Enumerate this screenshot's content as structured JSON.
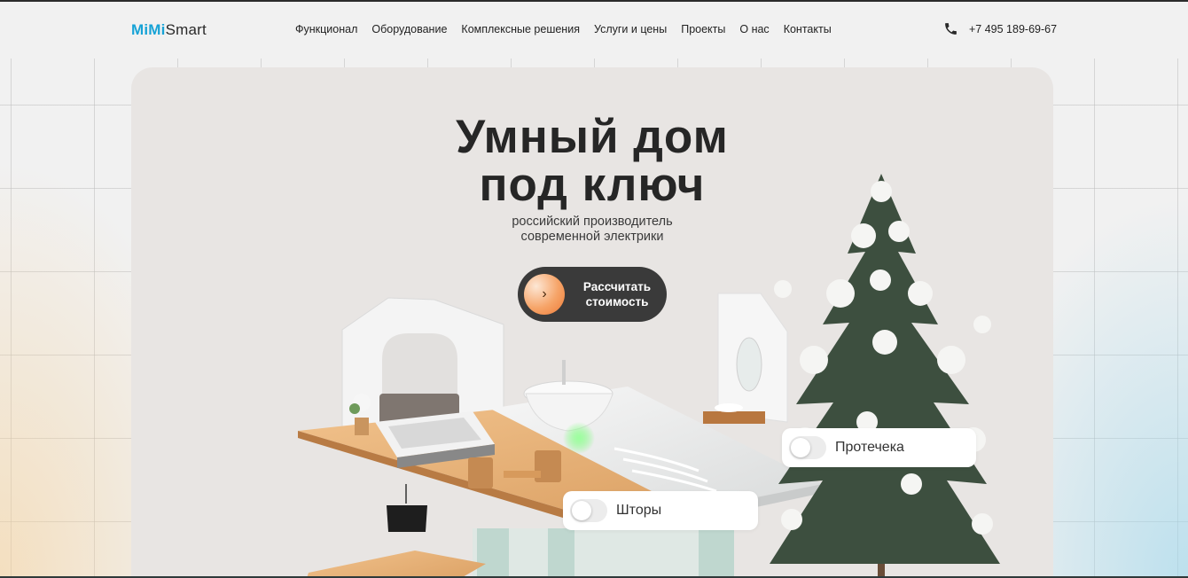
{
  "header": {
    "logo_part1": "MiMi",
    "logo_part2": "Smart",
    "nav": [
      {
        "label": "Функционал"
      },
      {
        "label": "Оборудование"
      },
      {
        "label": "Комплексные решения"
      },
      {
        "label": "Услуги и цены"
      },
      {
        "label": "Проекты"
      },
      {
        "label": "О нас"
      },
      {
        "label": "Контакты"
      }
    ],
    "phone_icon": "phone-icon",
    "phone": "+7 495 189-69-67"
  },
  "hero": {
    "title_line1": "Умный дом",
    "title_line2": "под ключ",
    "subtitle_line1": "российский производитель",
    "subtitle_line2": "современной электрики",
    "cta_icon": "chevron-right-icon",
    "cta_line1": "Рассчитать",
    "cta_line2": "стоимость",
    "toggles": [
      {
        "label": "Протечека",
        "on": false
      },
      {
        "label": "Шторы",
        "on": false
      }
    ]
  },
  "colors": {
    "accent": "#17a3d6",
    "cta_bg": "#3a3a3a",
    "cta_circle": "#f6a468",
    "hero_bg": "#e8e5e3"
  }
}
